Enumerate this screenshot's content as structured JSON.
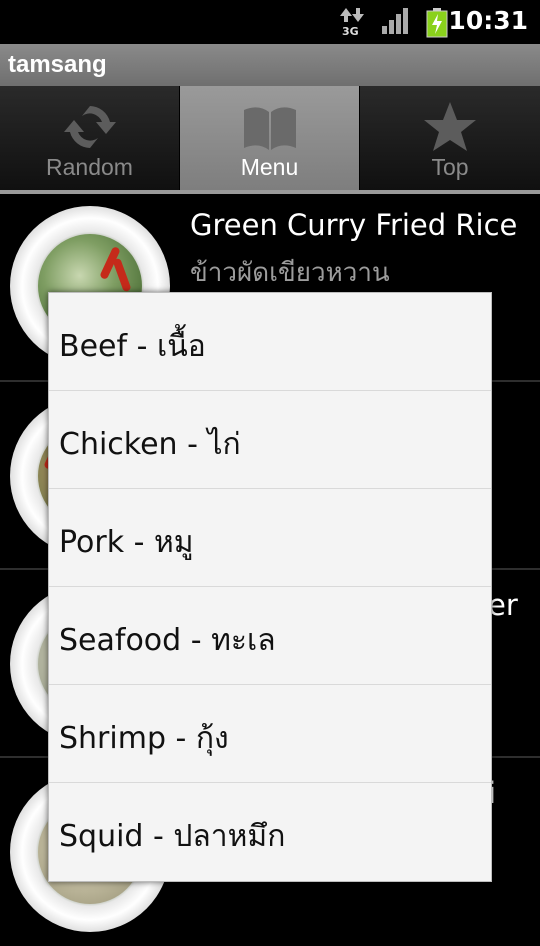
{
  "status_bar": {
    "network_label": "3G",
    "time": "10:31"
  },
  "app": {
    "title": "tamsang"
  },
  "tabs": [
    {
      "label": "Random",
      "icon": "refresh-icon",
      "active": false
    },
    {
      "label": "Menu",
      "icon": "book-icon",
      "active": true
    },
    {
      "label": "Top",
      "icon": "star-icon",
      "active": false
    }
  ],
  "list": {
    "items": [
      {
        "title": "Green Curry Fried Rice",
        "subtitle": "ข้าวผัดเขียวหวาน"
      },
      {
        "title": "",
        "subtitle": ""
      },
      {
        "title": "",
        "subtitle": "",
        "peek": "er"
      },
      {
        "title": "",
        "subtitle": "",
        "peek": "i"
      }
    ]
  },
  "popup_menu": {
    "items": [
      {
        "label": "Beef - เนื้อ"
      },
      {
        "label": "Chicken - ไก่"
      },
      {
        "label": "Pork - หมู"
      },
      {
        "label": "Seafood - ทะเล"
      },
      {
        "label": "Shrimp - กุ้ง"
      },
      {
        "label": "Squid - ปลาหมึก"
      }
    ]
  },
  "colors": {
    "title_bar": "#7f7f7f",
    "active_tab": "#8c8c8c",
    "popup_background": "#f4f4f4",
    "battery": "#8ad11c"
  }
}
